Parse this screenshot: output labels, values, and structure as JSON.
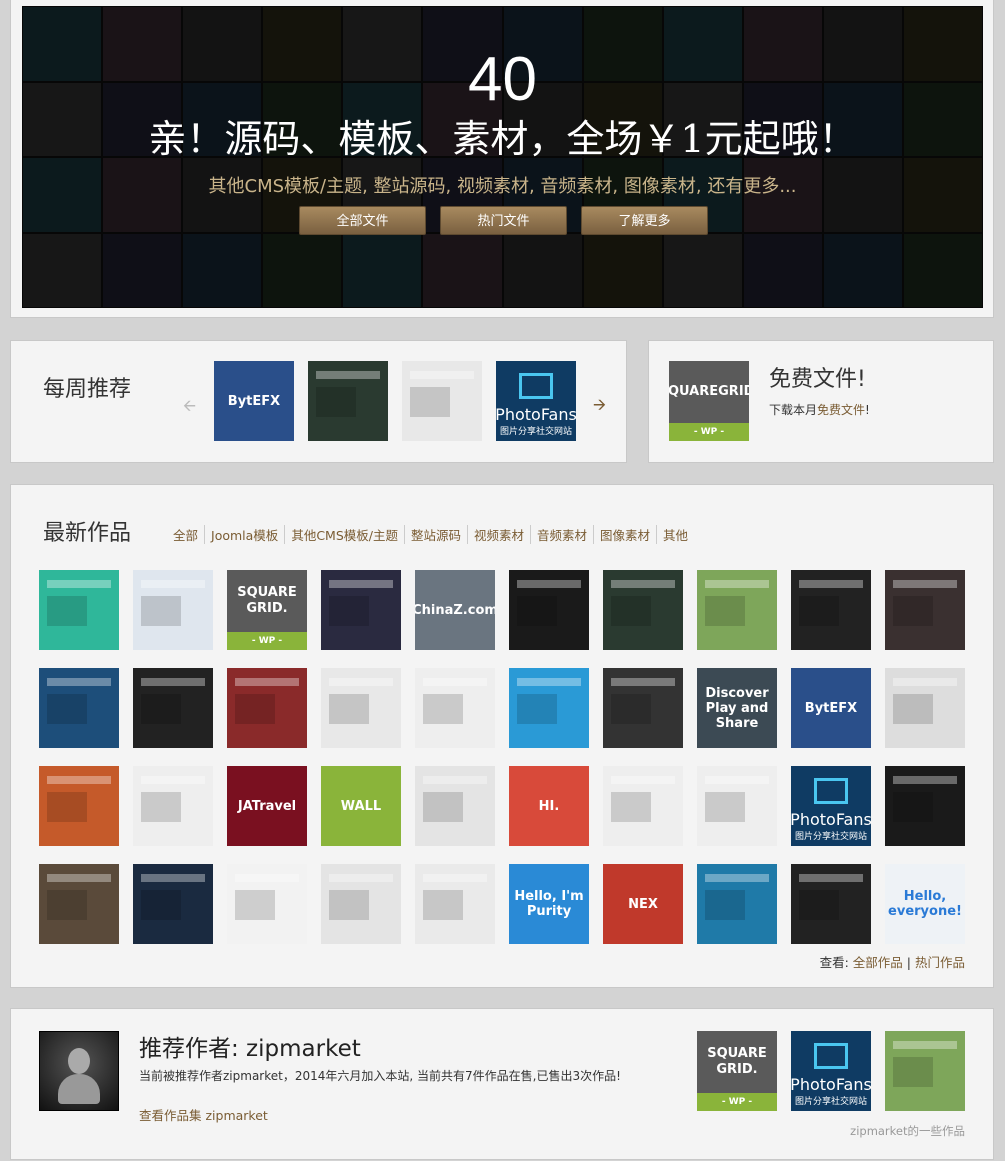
{
  "hero": {
    "count": "40",
    "headline": "亲！源码、模板、素材，全场￥1元起哦！",
    "subline": "其他CMS模板/主题, 整站源码, 视频素材, 音频素材, 图像素材, 还有更多...",
    "buttons": [
      "全部文件",
      "热门文件",
      "了解更多"
    ]
  },
  "weekly": {
    "title": "每周推荐",
    "prev_icon": "arrow-left-icon",
    "next_icon": "arrow-right-icon",
    "items": [
      {
        "label": "BytEFX",
        "color": "#2a4f8a"
      },
      {
        "label": "",
        "color": "#2a3a30"
      },
      {
        "label": "",
        "color": "#e8e8e8"
      },
      {
        "label": "PhotoFans",
        "color": "#0f3b63"
      }
    ]
  },
  "free": {
    "title": "免费文件!",
    "desc_prefix": "下载本月",
    "desc_link": "免费文件",
    "desc_suffix": "!",
    "thumb": {
      "line1": "SQUARE",
      "line2": "GRID.",
      "badge": "- WP -"
    }
  },
  "latest": {
    "title": "最新作品",
    "filters": [
      "全部",
      "Joomla模板",
      "其他CMS模板/主题",
      "整站源码",
      "视频素材",
      "音频素材",
      "图像素材",
      "其他"
    ],
    "items": [
      {
        "label": "",
        "color": "#2fb79a"
      },
      {
        "label": "",
        "color": "#dfe6ee"
      },
      {
        "label": "SQUARE GRID.",
        "color": "#5a5a5a"
      },
      {
        "label": "",
        "color": "#2a2a40"
      },
      {
        "label": "ChinaZ.com",
        "color": "#6a7580"
      },
      {
        "label": "",
        "color": "#1a1a1a"
      },
      {
        "label": "",
        "color": "#2a3a30"
      },
      {
        "label": "",
        "color": "#7ea65a"
      },
      {
        "label": "",
        "color": "#222"
      },
      {
        "label": "",
        "color": "#3a3030"
      },
      {
        "label": "",
        "color": "#1d4e7a"
      },
      {
        "label": "",
        "color": "#222"
      },
      {
        "label": "",
        "color": "#8a2a2a"
      },
      {
        "label": "",
        "color": "#e8e8e8"
      },
      {
        "label": "",
        "color": "#eee"
      },
      {
        "label": "",
        "color": "#2a9ad6"
      },
      {
        "label": "",
        "color": "#333"
      },
      {
        "label": "Discover Play and Share",
        "color": "#3c4a54"
      },
      {
        "label": "BytEFX",
        "color": "#2a4f8a"
      },
      {
        "label": "",
        "color": "#ddd"
      },
      {
        "label": "",
        "color": "#c55a2a"
      },
      {
        "label": "",
        "color": "#eee"
      },
      {
        "label": "JATravel",
        "color": "#7a1020"
      },
      {
        "label": "WALL",
        "color": "#8ab43a"
      },
      {
        "label": "",
        "color": "#e4e4e4"
      },
      {
        "label": "HI.",
        "color": "#d84a3a"
      },
      {
        "label": "",
        "color": "#eee"
      },
      {
        "label": "",
        "color": "#eee"
      },
      {
        "label": "PhotoFans",
        "color": "#0f3b63"
      },
      {
        "label": "",
        "color": "#1a1a1a"
      },
      {
        "label": "",
        "color": "#5a4a3a"
      },
      {
        "label": "",
        "color": "#1a2a40"
      },
      {
        "label": "",
        "color": "#f2f2f2"
      },
      {
        "label": "",
        "color": "#e4e4e4"
      },
      {
        "label": "",
        "color": "#eaeaea"
      },
      {
        "label": "Hello, I'm Purity",
        "color": "#2a8ad6"
      },
      {
        "label": "NEX",
        "color": "#c0392b"
      },
      {
        "label": "",
        "color": "#1f7aa8"
      },
      {
        "label": "",
        "color": "#222"
      },
      {
        "label": "Hello, everyone!",
        "color": "#eef2f6"
      }
    ],
    "view_label": "查看:",
    "view_all": "全部作品",
    "view_hot": "热门作品"
  },
  "author": {
    "title": "推荐作者: zipmarket",
    "avatar_icon": "user-silhouette-icon",
    "desc": "当前被推荐作者zipmarket，2014年六月加入本站, 当前共有7件作品在售,已售出3次作品!",
    "link": "查看作品集 zipmarket",
    "caption": "zipmarket的一些作品",
    "items": [
      {
        "label": "SQUARE GRID.",
        "color": "#5a5a5a"
      },
      {
        "label": "PhotoFans",
        "color": "#0f3b63"
      },
      {
        "label": "",
        "color": "#7ea65a"
      }
    ]
  }
}
